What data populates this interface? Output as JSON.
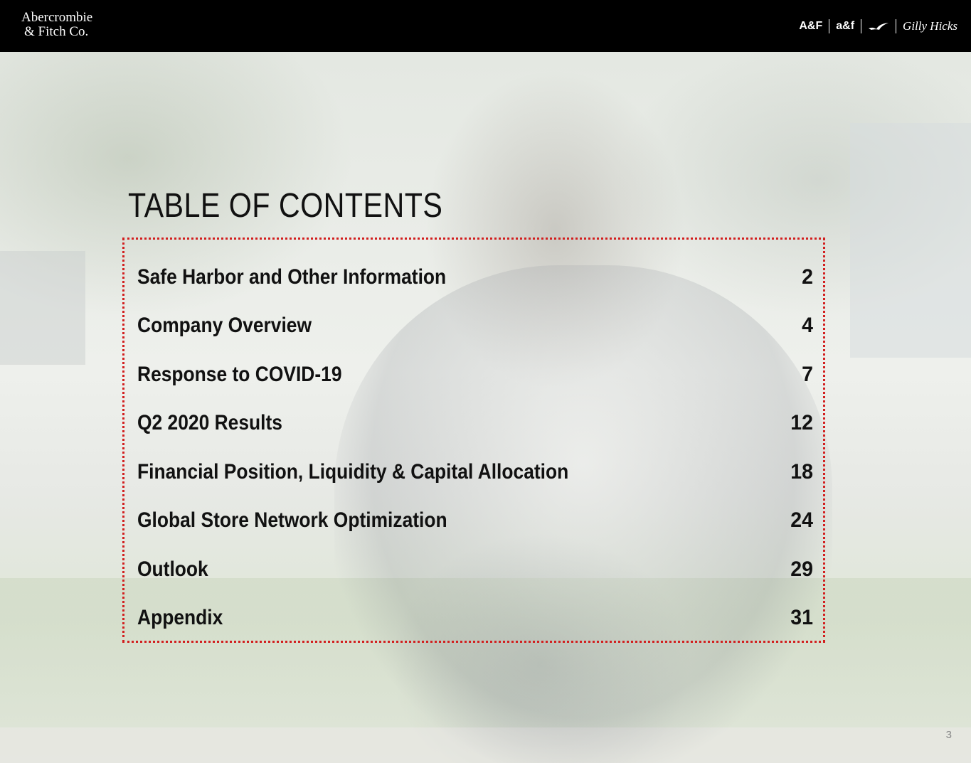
{
  "header": {
    "logo_line1": "Abercrombie",
    "logo_line2": "& Fitch Co.",
    "brands": [
      "A&F",
      "a&f",
      "Gilly Hicks"
    ],
    "brand_icon": "seagull-icon"
  },
  "title": "TABLE OF CONTENTS",
  "toc": [
    {
      "label": "Safe Harbor and Other Information",
      "page": "2"
    },
    {
      "label": "Company Overview",
      "page": "4"
    },
    {
      "label": "Response to COVID-19",
      "page": "7"
    },
    {
      "label": "Q2 2020 Results",
      "page": "12"
    },
    {
      "label": "Financial Position, Liquidity & Capital Allocation",
      "page": "18"
    },
    {
      "label": "Global Store Network Optimization",
      "page": "24"
    },
    {
      "label": "Outlook",
      "page": "29"
    },
    {
      "label": "Appendix",
      "page": "31"
    }
  ],
  "slide_number": "3",
  "colors": {
    "accent": "#d21f1f",
    "header_bg": "#000000",
    "text": "#111111"
  }
}
